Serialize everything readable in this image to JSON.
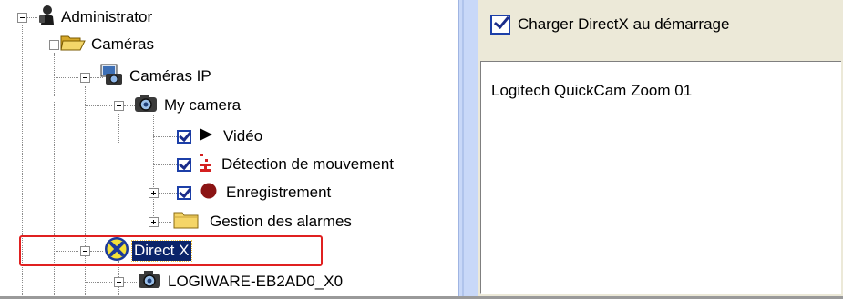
{
  "tree": {
    "nodes": [
      {
        "label": "Administrator",
        "icon": "admin-icon",
        "expander": "minus"
      },
      {
        "label": "Caméras",
        "icon": "folder-open-icon",
        "expander": "minus"
      },
      {
        "label": "Caméras IP",
        "icon": "ip-camera-icon",
        "expander": "minus"
      },
      {
        "label": "My camera",
        "icon": "camera-icon",
        "expander": "minus"
      },
      {
        "label": "Vidéo",
        "icon": "play-icon",
        "checked": true
      },
      {
        "label": "Détection de mouvement",
        "icon": "motion-detection-icon",
        "checked": true
      },
      {
        "label": "Enregistrement",
        "icon": "record-icon",
        "checked": true,
        "expander": "plus"
      },
      {
        "label": "Gestion des alarmes",
        "icon": "folder-icon",
        "expander": "plus"
      },
      {
        "label": "Direct X",
        "icon": "directx-icon",
        "expander": "minus",
        "selected": true
      },
      {
        "label": "LOGIWARE-EB2AD0_X0",
        "icon": "camera-icon",
        "expander": "minus"
      }
    ]
  },
  "settings": {
    "load_directx_label": "Charger DirectX au démarrage",
    "load_directx_checked": true,
    "devices": [
      "Logitech QuickCam Zoom 01"
    ]
  },
  "colors": {
    "selection_bg": "#0a246a",
    "highlight_border": "#e02020",
    "panel_bg": "#ece9d8",
    "splitter": "#c8d8f8",
    "check_color": "#1c3fa8"
  }
}
